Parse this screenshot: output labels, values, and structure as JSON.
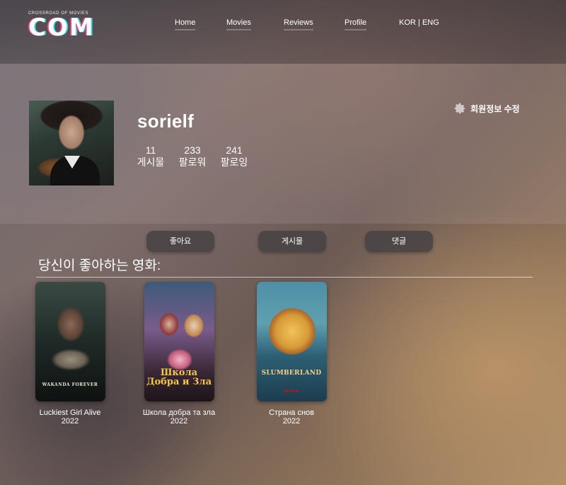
{
  "brand": {
    "tagline": "CROSSROAD OF MOVIES",
    "logo_text": "COM"
  },
  "nav": {
    "items": [
      {
        "label": "Home"
      },
      {
        "label": "Movies"
      },
      {
        "label": "Reviews"
      },
      {
        "label": "Profile"
      }
    ],
    "lang_kor": "KOR",
    "lang_sep": " | ",
    "lang_eng": "ENG"
  },
  "profile": {
    "username": "sorielf",
    "edit_label": "회원정보 수정",
    "stats": [
      {
        "value": "11",
        "label": "게시물"
      },
      {
        "value": "233",
        "label": "팔로워"
      },
      {
        "value": "241",
        "label": "팔로잉"
      }
    ]
  },
  "tabs": [
    {
      "label": "좋아요"
    },
    {
      "label": "게시물"
    },
    {
      "label": "댓글"
    }
  ],
  "section_title": "당신이 좋아하는 영화:",
  "movies": [
    {
      "title": "Luckiest Girl Alive",
      "year": "2022",
      "poster_text": "WAKANDA FOREVER"
    },
    {
      "title": "Школа добра та зла",
      "year": "2022",
      "poster_text": "Школа Добра и Зла"
    },
    {
      "title": "Страна снов",
      "year": "2022",
      "poster_text": "SLUMBERLAND",
      "poster_badge": "NETFLIX"
    }
  ],
  "colors": {
    "logo_cyan": "#3fd4e0",
    "logo_pink": "#e0457a",
    "tab_bg": "#464244"
  }
}
